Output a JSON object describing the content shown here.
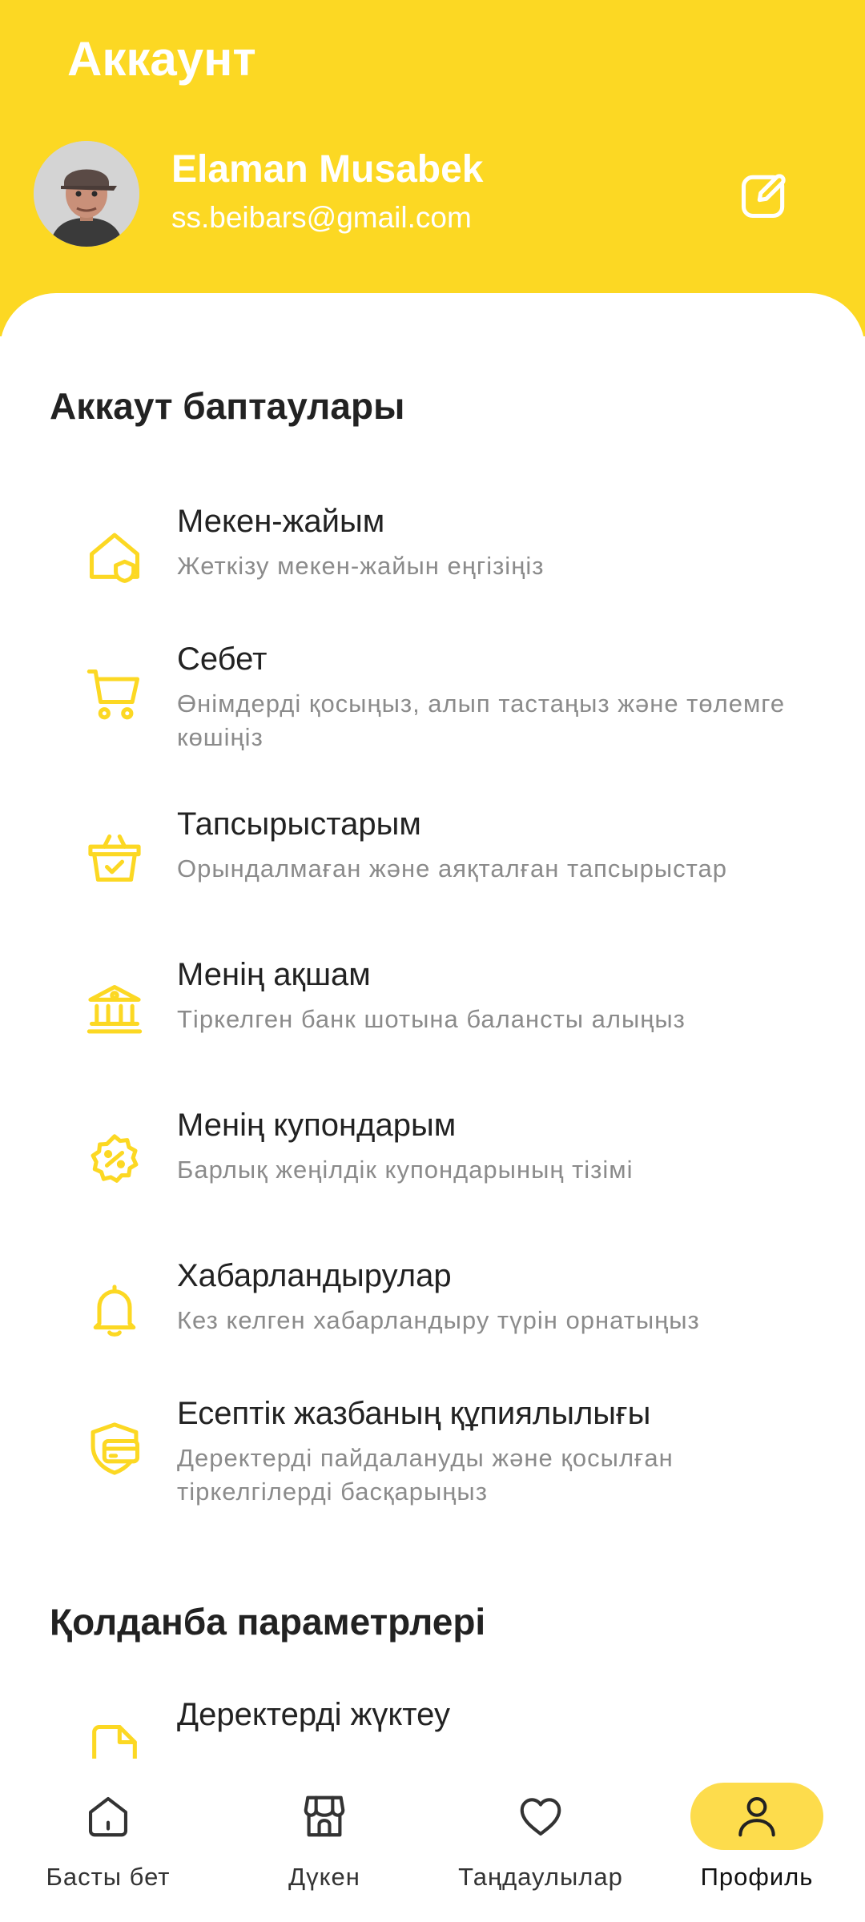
{
  "header": {
    "title": "Аккаунт",
    "user_name": "Elaman Musabek",
    "user_email": "ss.beibars@gmail.com",
    "edit_icon": "edit-icon",
    "background_color": "#FCD823"
  },
  "account_settings": {
    "title": "Аккаут баптаулары",
    "items": [
      {
        "title": "Мекен-жайым",
        "subtitle": "Жеткізу мекен-жайын еңгізіңіз",
        "icon": "home-address-icon"
      },
      {
        "title": "Себет",
        "subtitle": "Өнімдерді қосыңыз, алып тастаңыз және төлемге көшіңіз",
        "icon": "cart-icon"
      },
      {
        "title": "Тапсырыстарым",
        "subtitle": "Орындалмаған және аяқталған тапсырыстар",
        "icon": "basket-check-icon"
      },
      {
        "title": "Менің ақшам",
        "subtitle": "Тіркелген банк шотына балансты алыңыз",
        "icon": "bank-icon"
      },
      {
        "title": "Менің купондарым",
        "subtitle": "Барлық жеңілдік купондарының тізімі",
        "icon": "discount-badge-icon"
      },
      {
        "title": "Хабарландырулар",
        "subtitle": "Кез келген хабарландыру түрін орнатыңыз",
        "icon": "bell-icon"
      },
      {
        "title": "Есептік жазбаның құпиялылығы",
        "subtitle": "Деректерді пайдалануды және қосылған тіркелгілерді басқарыңыз",
        "icon": "security-card-icon"
      }
    ]
  },
  "app_settings": {
    "title": "Қолданба параметрлері",
    "items": [
      {
        "title": "Деректерді жүктеу",
        "icon": "document-upload-icon"
      }
    ]
  },
  "bottom_nav": {
    "items": [
      {
        "label": "Басты бет",
        "icon": "home-icon",
        "active": false
      },
      {
        "label": "Дүкен",
        "icon": "shop-icon",
        "active": false
      },
      {
        "label": "Таңдаулылар",
        "icon": "heart-icon",
        "active": false
      },
      {
        "label": "Профиль",
        "icon": "user-icon",
        "active": true
      }
    ]
  },
  "colors": {
    "accent": "#FCD823",
    "icon": "#FCD823",
    "active_nav_bg": "#FDDC4C"
  }
}
